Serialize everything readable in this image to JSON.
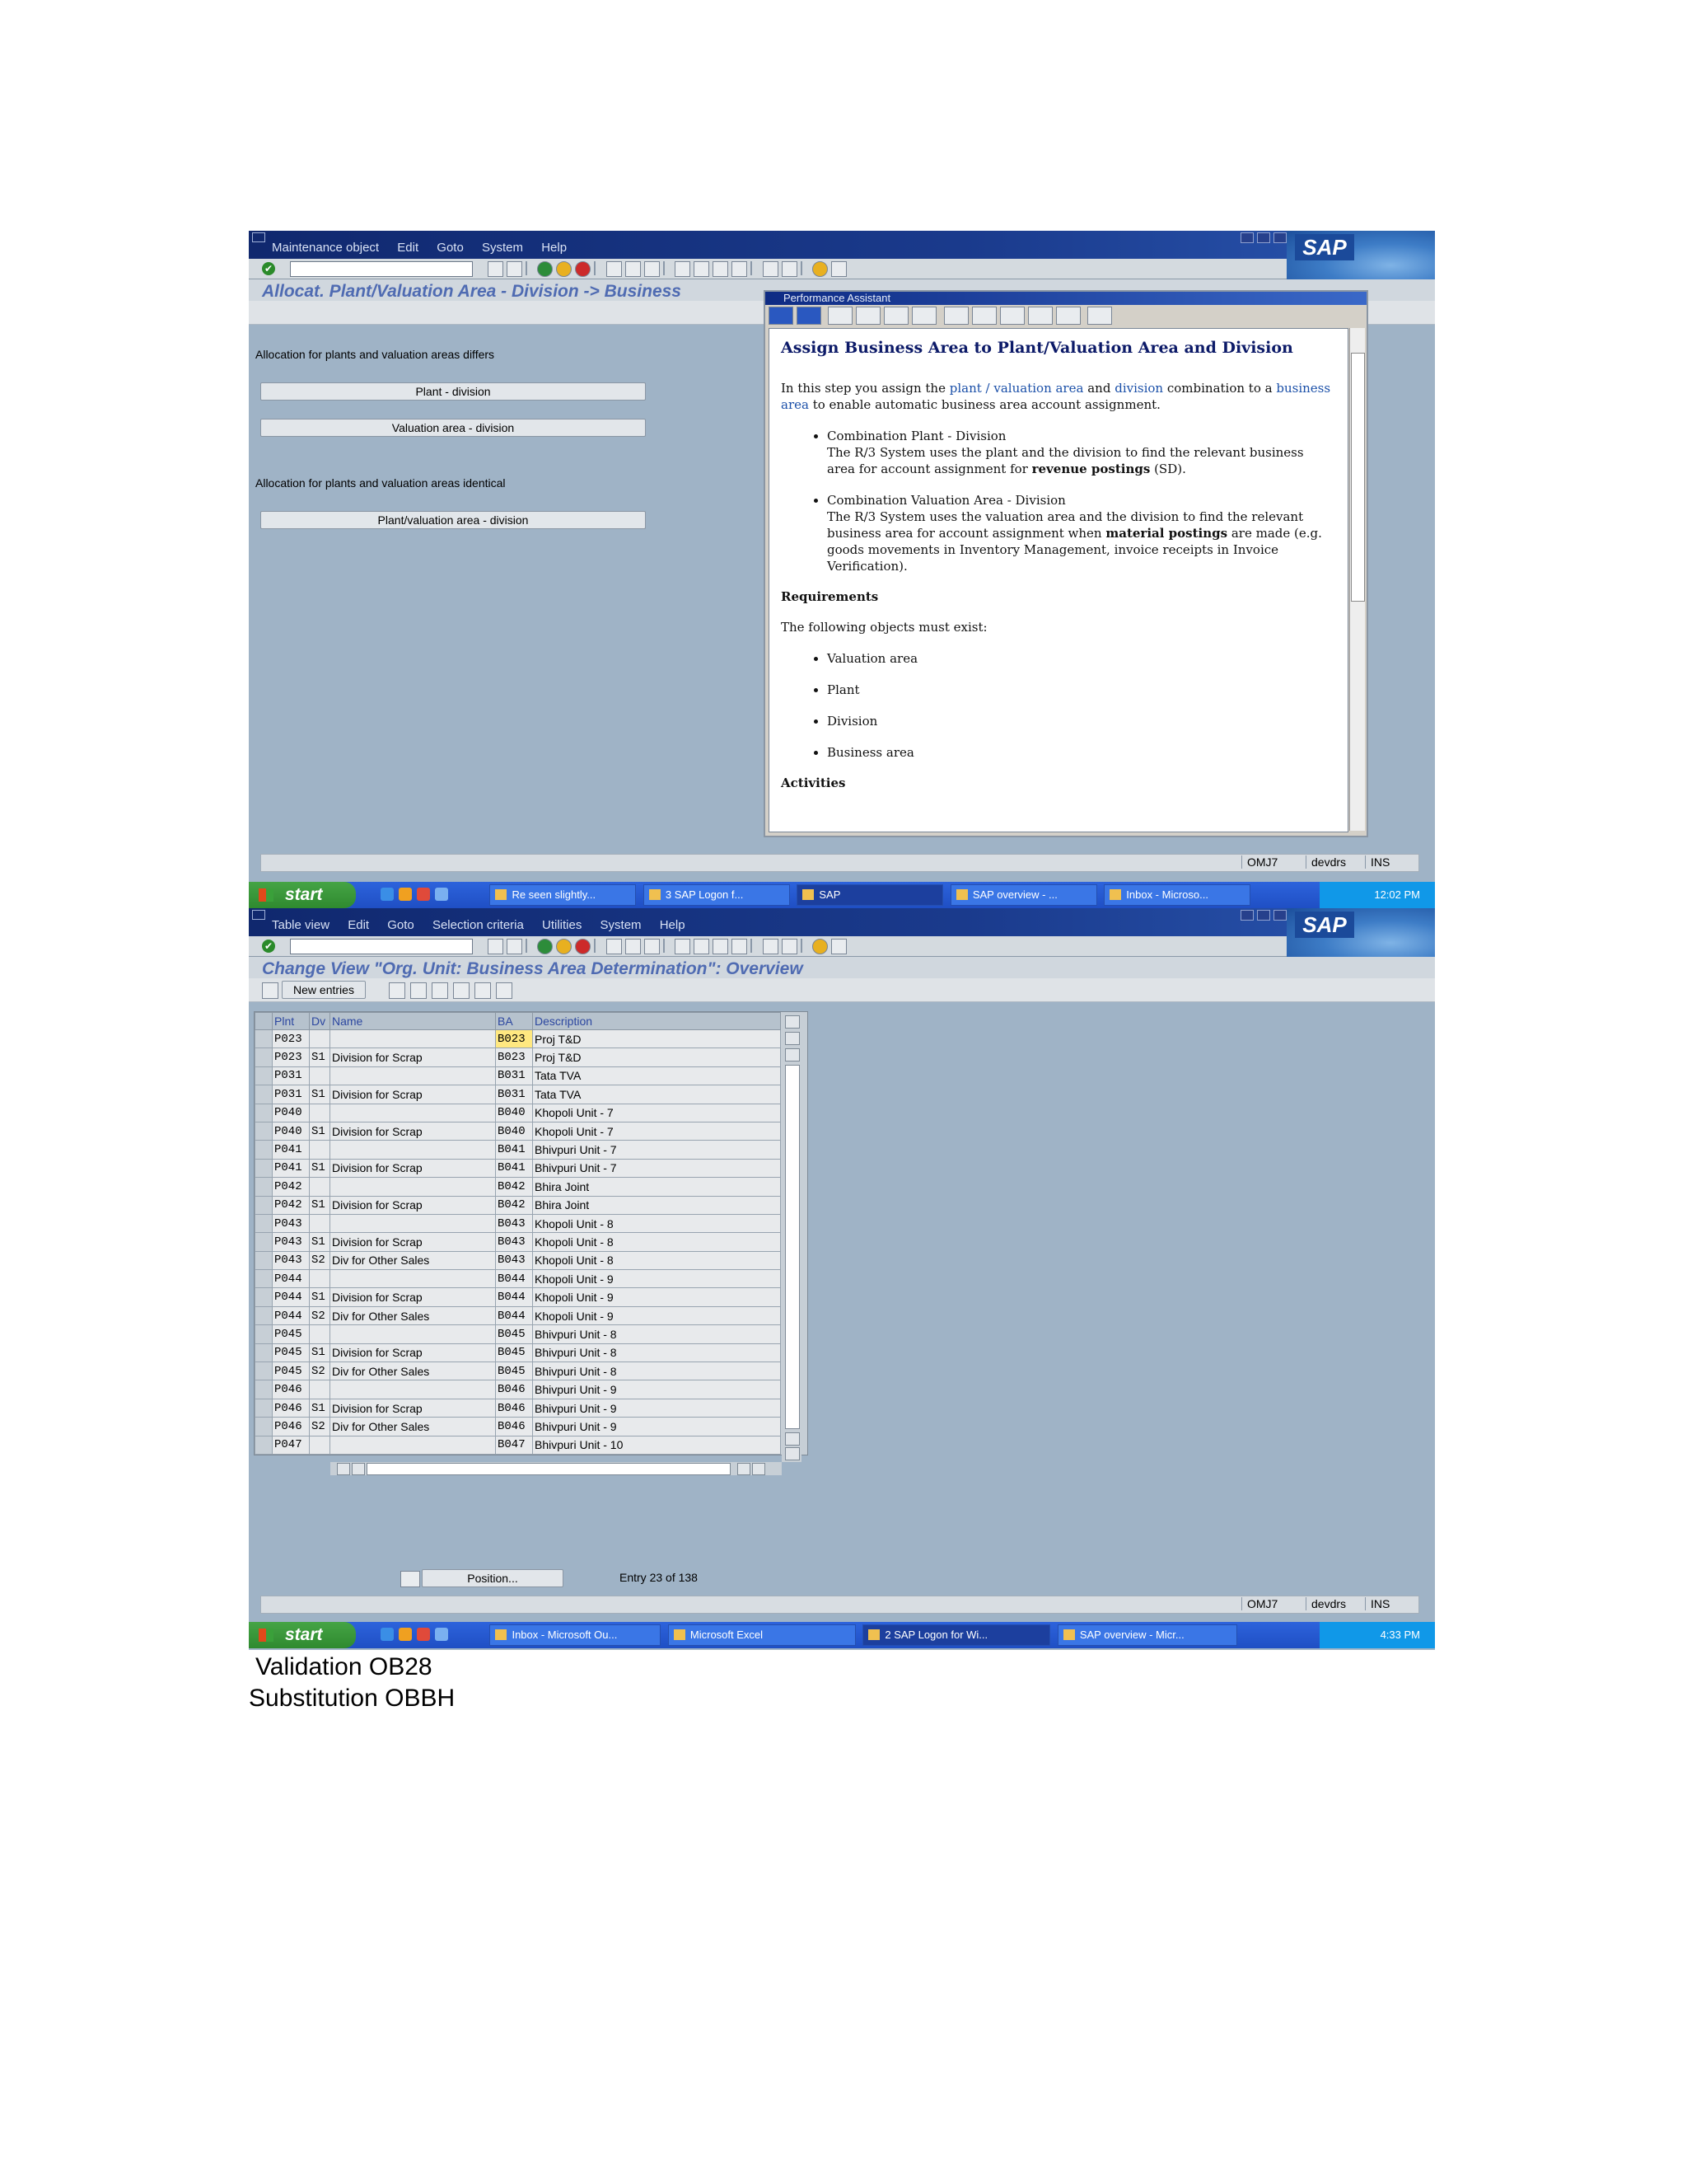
{
  "screen1": {
    "menu": [
      "Maintenance object",
      "Edit",
      "Goto",
      "System",
      "Help"
    ],
    "title": "Allocat. Plant/Valuation Area - Division -> Business",
    "logo": "SAP",
    "label_differs": "Allocation for plants and valuation areas differs",
    "btn_plant_division": "Plant - division",
    "btn_valuation_division": "Valuation area - division",
    "label_identical": "Allocation for plants and valuation areas identical",
    "btn_plantval_division": "Plant/valuation area - division",
    "status": {
      "tcode": "OMJ7",
      "server": "devdrs",
      "mode": "INS"
    },
    "assistant": {
      "window_title": "Performance Assistant",
      "heading": "Assign Business Area to Plant/Valuation Area and Division",
      "intro_1": "In this step you assign the",
      "intro_plant": "plant",
      "intro_slash": "/",
      "intro_valuation": "valuation area",
      "intro_and": "and",
      "intro_division": "division",
      "intro_2": "combination to a",
      "intro_business": "business area",
      "intro_3": "to enable automatic business area account assignment.",
      "bullet1_title": "Combination Plant - Division",
      "bullet1_text_a": "The R/3 System uses the plant and the division to find the relevant business area for account assignment for",
      "bullet1_bold": "revenue postings",
      "bullet1_text_b": "(SD).",
      "bullet2_title": "Combination Valuation Area - Division",
      "bullet2_text_a": "The R/3 System uses the valuation area and the division to find the relevant business area for account assignment when",
      "bullet2_bold": "material postings",
      "bullet2_text_b": "are made (e.g. goods movements in Inventory Management, invoice receipts in Invoice Verification).",
      "requirements": "Requirements",
      "req_text": "The following objects must exist:",
      "req_items": [
        "Valuation area",
        "Plant",
        "Division",
        "Business area"
      ],
      "activities": "Activities"
    },
    "taskbar": {
      "start": "start",
      "tasks": [
        "Re seen slightly...",
        "3 SAP Logon f...",
        "SAP",
        "SAP overview - ...",
        "Inbox - Microso..."
      ],
      "clock": "12:02 PM"
    }
  },
  "screen2": {
    "menu": [
      "Table view",
      "Edit",
      "Goto",
      "Selection criteria",
      "Utilities",
      "System",
      "Help"
    ],
    "title": "Change View \"Org. Unit: Business Area Determination\": Overview",
    "logo": "SAP",
    "new_entries": "New entries",
    "columns": [
      "Plnt",
      "Dv",
      "Name",
      "BA",
      "Description"
    ],
    "rows": [
      [
        "P023",
        "",
        "",
        "B023",
        "Proj T&D"
      ],
      [
        "P023",
        "S1",
        "Division for Scrap",
        "B023",
        "Proj T&D"
      ],
      [
        "P031",
        "",
        "",
        "B031",
        "Tata TVA"
      ],
      [
        "P031",
        "S1",
        "Division for Scrap",
        "B031",
        "Tata TVA"
      ],
      [
        "P040",
        "",
        "",
        "B040",
        "Khopoli  Unit - 7"
      ],
      [
        "P040",
        "S1",
        "Division for Scrap",
        "B040",
        "Khopoli  Unit - 7"
      ],
      [
        "P041",
        "",
        "",
        "B041",
        "Bhivpuri Unit - 7"
      ],
      [
        "P041",
        "S1",
        "Division for Scrap",
        "B041",
        "Bhivpuri Unit - 7"
      ],
      [
        "P042",
        "",
        "",
        "B042",
        "Bhira Joint"
      ],
      [
        "P042",
        "S1",
        "Division for Scrap",
        "B042",
        "Bhira Joint"
      ],
      [
        "P043",
        "",
        "",
        "B043",
        "Khopoli  Unit - 8"
      ],
      [
        "P043",
        "S1",
        "Division for Scrap",
        "B043",
        "Khopoli  Unit - 8"
      ],
      [
        "P043",
        "S2",
        "Div for Other Sales",
        "B043",
        "Khopoli  Unit - 8"
      ],
      [
        "P044",
        "",
        "",
        "B044",
        "Khopoli  Unit - 9"
      ],
      [
        "P044",
        "S1",
        "Division for Scrap",
        "B044",
        "Khopoli  Unit - 9"
      ],
      [
        "P044",
        "S2",
        "Div for Other Sales",
        "B044",
        "Khopoli  Unit - 9"
      ],
      [
        "P045",
        "",
        "",
        "B045",
        "Bhivpuri Unit - 8"
      ],
      [
        "P045",
        "S1",
        "Division for Scrap",
        "B045",
        "Bhivpuri Unit - 8"
      ],
      [
        "P045",
        "S2",
        "Div for Other Sales",
        "B045",
        "Bhivpuri Unit - 8"
      ],
      [
        "P046",
        "",
        "",
        "B046",
        "Bhivpuri Unit - 9"
      ],
      [
        "P046",
        "S1",
        "Division for Scrap",
        "B046",
        "Bhivpuri Unit - 9"
      ],
      [
        "P046",
        "S2",
        "Div for Other Sales",
        "B046",
        "Bhivpuri Unit - 9"
      ],
      [
        "P047",
        "",
        "",
        "B047",
        "Bhivpuri Unit - 10"
      ]
    ],
    "position_btn": "Position...",
    "entry_info": "Entry 23 of 138",
    "status": {
      "tcode": "OMJ7",
      "server": "devdrs",
      "mode": "INS"
    },
    "taskbar": {
      "start": "start",
      "tasks": [
        "Inbox - Microsoft Ou...",
        "Microsoft Excel",
        "2 SAP Logon for Wi...",
        "SAP overview - Micr..."
      ],
      "clock": "4:33 PM"
    }
  },
  "captions": {
    "validation": "Validation OB28",
    "substitution": "Substitution  OBBH"
  }
}
